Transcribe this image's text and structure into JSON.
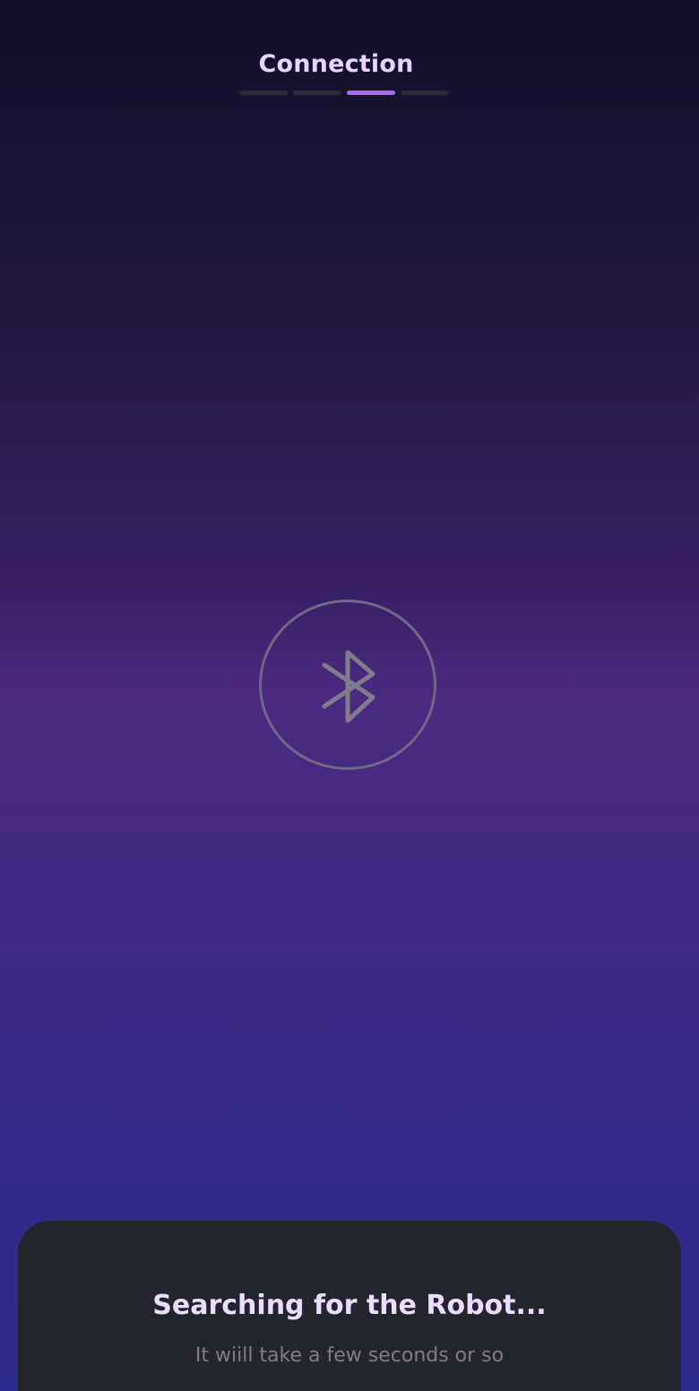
{
  "header": {
    "title": "Connection",
    "steps_total": 4,
    "steps_active": 3
  },
  "status": {
    "icon": "bluetooth-icon",
    "title": "Searching for the Robot...",
    "subtitle": "It wiill take a few seconds or so"
  },
  "colors": {
    "accent": "#a56cf0",
    "title": "#e8d5ff",
    "sheet": "#23252d",
    "icon": "#7f7d8c"
  }
}
